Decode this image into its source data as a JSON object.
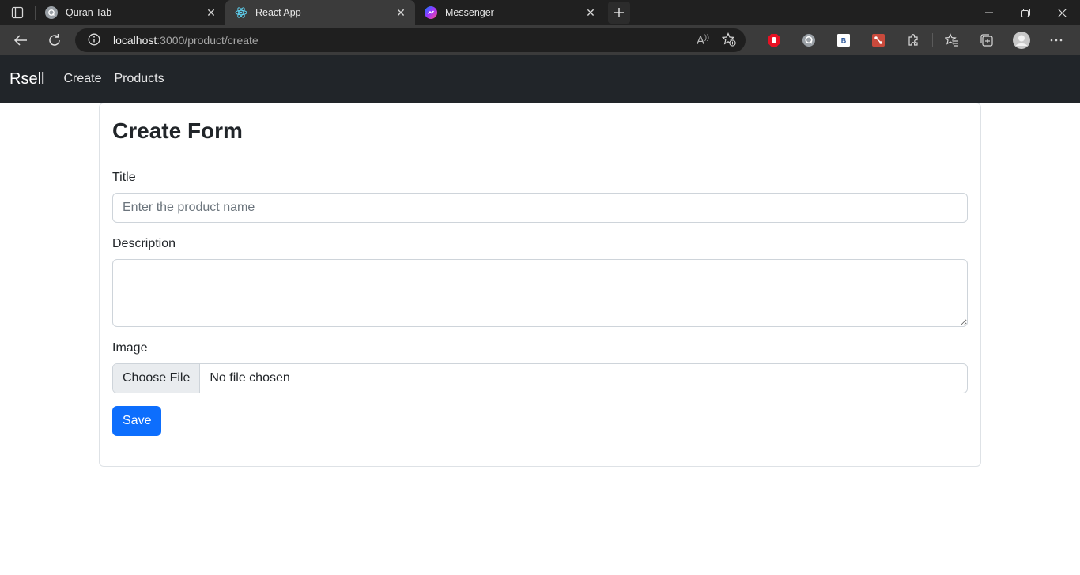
{
  "browser": {
    "tabs": [
      {
        "title": "Quran Tab",
        "active": false,
        "icon": "quran-tab-icon"
      },
      {
        "title": "React App",
        "active": true,
        "icon": "react-icon"
      },
      {
        "title": "Messenger",
        "active": false,
        "icon": "messenger-icon"
      }
    ],
    "address": {
      "host": "localhost",
      "path": ":3000/product/create"
    }
  },
  "navbar": {
    "brand": "Rsell",
    "links": [
      "Create",
      "Products"
    ]
  },
  "form": {
    "title": "Create Form",
    "title_label": "Title",
    "title_placeholder": "Enter the product name",
    "description_label": "Description",
    "image_label": "Image",
    "choose_file": "Choose File",
    "no_file": "No file chosen",
    "save": "Save"
  },
  "colors": {
    "navbar_bg": "#212529",
    "primary": "#0d6efd"
  }
}
